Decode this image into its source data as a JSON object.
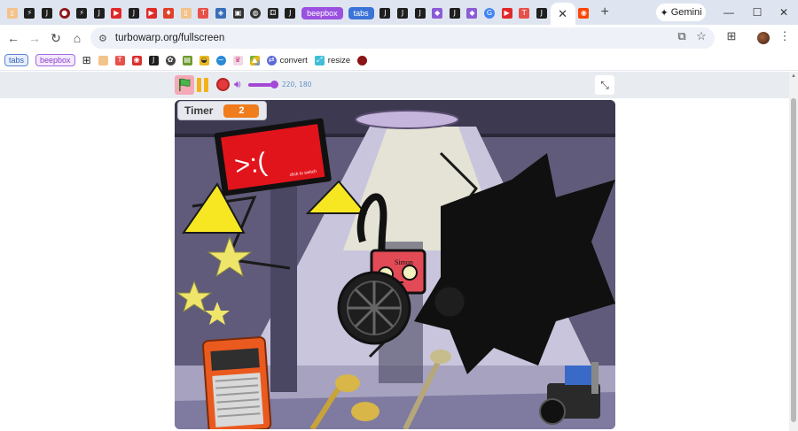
{
  "browser": {
    "tabs": [
      {
        "icon": "file-icon",
        "color": "#f2c38a",
        "glyph": "▯"
      },
      {
        "icon": "lightning-icon",
        "color": "#1f1f1f",
        "glyph": "⚡"
      },
      {
        "icon": "js-icon",
        "color": "#1f1f1f",
        "glyph": "J"
      },
      {
        "icon": "record-icon",
        "color": "#8b1a1a",
        "glyph": "●",
        "round": true
      },
      {
        "icon": "lightning-icon",
        "color": "#1f1f1f",
        "glyph": "⚡"
      },
      {
        "icon": "js-icon",
        "color": "#1f1f1f",
        "glyph": "J"
      },
      {
        "icon": "youtube-icon",
        "color": "#e02a2a",
        "glyph": "▶"
      },
      {
        "icon": "js-icon",
        "color": "#1f1f1f",
        "glyph": "J"
      },
      {
        "icon": "youtube-icon",
        "color": "#e02a2a",
        "glyph": "▶"
      },
      {
        "icon": "fire-icon",
        "color": "#e0402a",
        "glyph": "♦"
      },
      {
        "icon": "file-icon",
        "color": "#f2c38a",
        "glyph": "▯"
      },
      {
        "icon": "tw-icon",
        "color": "#e8504a",
        "glyph": "T"
      },
      {
        "icon": "shield-icon",
        "color": "#3a6fb8",
        "glyph": "◈"
      },
      {
        "icon": "image-icon",
        "color": "#333333",
        "glyph": "▣"
      },
      {
        "icon": "globe-icon",
        "color": "#333333",
        "glyph": "◍",
        "round": true
      },
      {
        "icon": "dice-icon",
        "color": "#222222",
        "glyph": "⚃"
      },
      {
        "icon": "js-icon",
        "color": "#1f1f1f",
        "glyph": "J"
      }
    ],
    "pill_tab_1": "beepbox",
    "pill_tab_2": "tabs",
    "tabs_after": [
      {
        "icon": "js-icon",
        "color": "#1f1f1f",
        "glyph": "J"
      },
      {
        "icon": "js-icon",
        "color": "#1f1f1f",
        "glyph": "J"
      },
      {
        "icon": "js-icon",
        "color": "#1f1f1f",
        "glyph": "J"
      },
      {
        "icon": "cube-icon",
        "color": "#8c5bd6",
        "glyph": "◆"
      },
      {
        "icon": "js-icon",
        "color": "#1f1f1f",
        "glyph": "J"
      },
      {
        "icon": "cube-icon",
        "color": "#8c5bd6",
        "glyph": "◆"
      },
      {
        "icon": "google-icon",
        "color": "#4285f4",
        "glyph": "G",
        "round": true
      },
      {
        "icon": "youtube-icon",
        "color": "#e02a2a",
        "glyph": "▶"
      },
      {
        "icon": "tw-icon",
        "color": "#e8504a",
        "glyph": "T"
      },
      {
        "icon": "js-icon",
        "color": "#1f1f1f",
        "glyph": "J"
      }
    ],
    "active_tab_close": "✕",
    "tab_after_active": {
      "icon": "reddit-icon",
      "color": "#ff4500",
      "glyph": "◉"
    },
    "new_tab": "+",
    "gemini_label": "Gemini",
    "address": "turbowarp.org/fullscreen",
    "bookmarks": {
      "pill_tabs": "tabs",
      "pill_beepbox": "beepbox",
      "convert": "convert",
      "resize": "resize"
    }
  },
  "player": {
    "timer_label": "Timer",
    "timer_value": "2",
    "mouse_coords": "220, 180",
    "volume_level": 0.8
  },
  "stage": {
    "screen_text": ">:(",
    "screen_subtext": "click to switch",
    "robot_label": "Simon"
  },
  "colors": {
    "accent_purple": "#a446d6",
    "flag_green": "#4bb34b",
    "stop_red": "#e23b3b",
    "timer_orange": "#f07c1b"
  }
}
